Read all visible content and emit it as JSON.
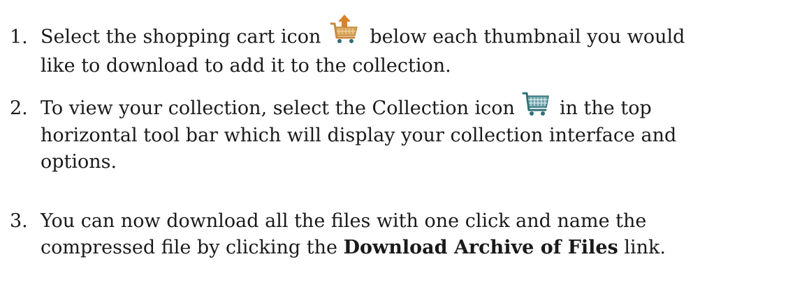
{
  "steps": [
    {
      "number": "1.",
      "line1_before_icon": "Select the shopping cart icon",
      "icon": "shopping-cart-add-icon",
      "line1_after_icon": "below each thumbnail you would",
      "line2": "like to download to add it to the collection."
    },
    {
      "number": "2.",
      "line1_before_icon": "To view your collection, select the Collection icon",
      "icon": "shopping-cart-icon",
      "line1_after_icon": "in the top",
      "line2": "horizontal tool bar which will display your collection interface and",
      "line3": "options."
    },
    {
      "number": "3.",
      "line1": "You can now download all the files with one click and name the",
      "line2_before_bold": "compressed file by clicking the",
      "line2_bold": "Download Archive of Files",
      "line2_after_bold": "link."
    }
  ],
  "colors": {
    "cart_orange": "#c9893a",
    "cart_teal": "#2f6f78",
    "arrow_orange": "#d9822b"
  }
}
